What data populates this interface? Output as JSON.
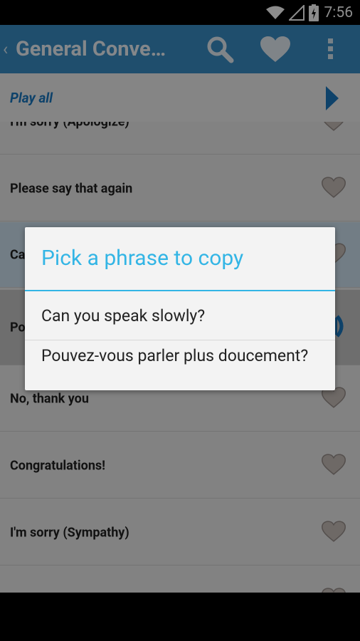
{
  "status": {
    "time": "7:56"
  },
  "actionbar": {
    "back": "‹",
    "title": "General Conve…"
  },
  "playbar": {
    "label": "Play all"
  },
  "phrases": [
    {
      "label": "I'm sorry (Apologize)"
    },
    {
      "label": "Please say that again"
    },
    {
      "label": "Ca"
    },
    {
      "label": "Po"
    },
    {
      "label": "No, thank you"
    },
    {
      "label": "Congratulations!"
    },
    {
      "label": "I'm sorry (Sympathy)"
    },
    {
      "label": ""
    }
  ],
  "dialog": {
    "title": "Pick a phrase to copy",
    "options": [
      "Can you speak slowly?",
      "Pouvez-vous parler plus doucement?"
    ]
  },
  "colors": {
    "accent": "#33b5e5",
    "actionbar": "#3a8fc7",
    "link": "#1a78c2"
  }
}
